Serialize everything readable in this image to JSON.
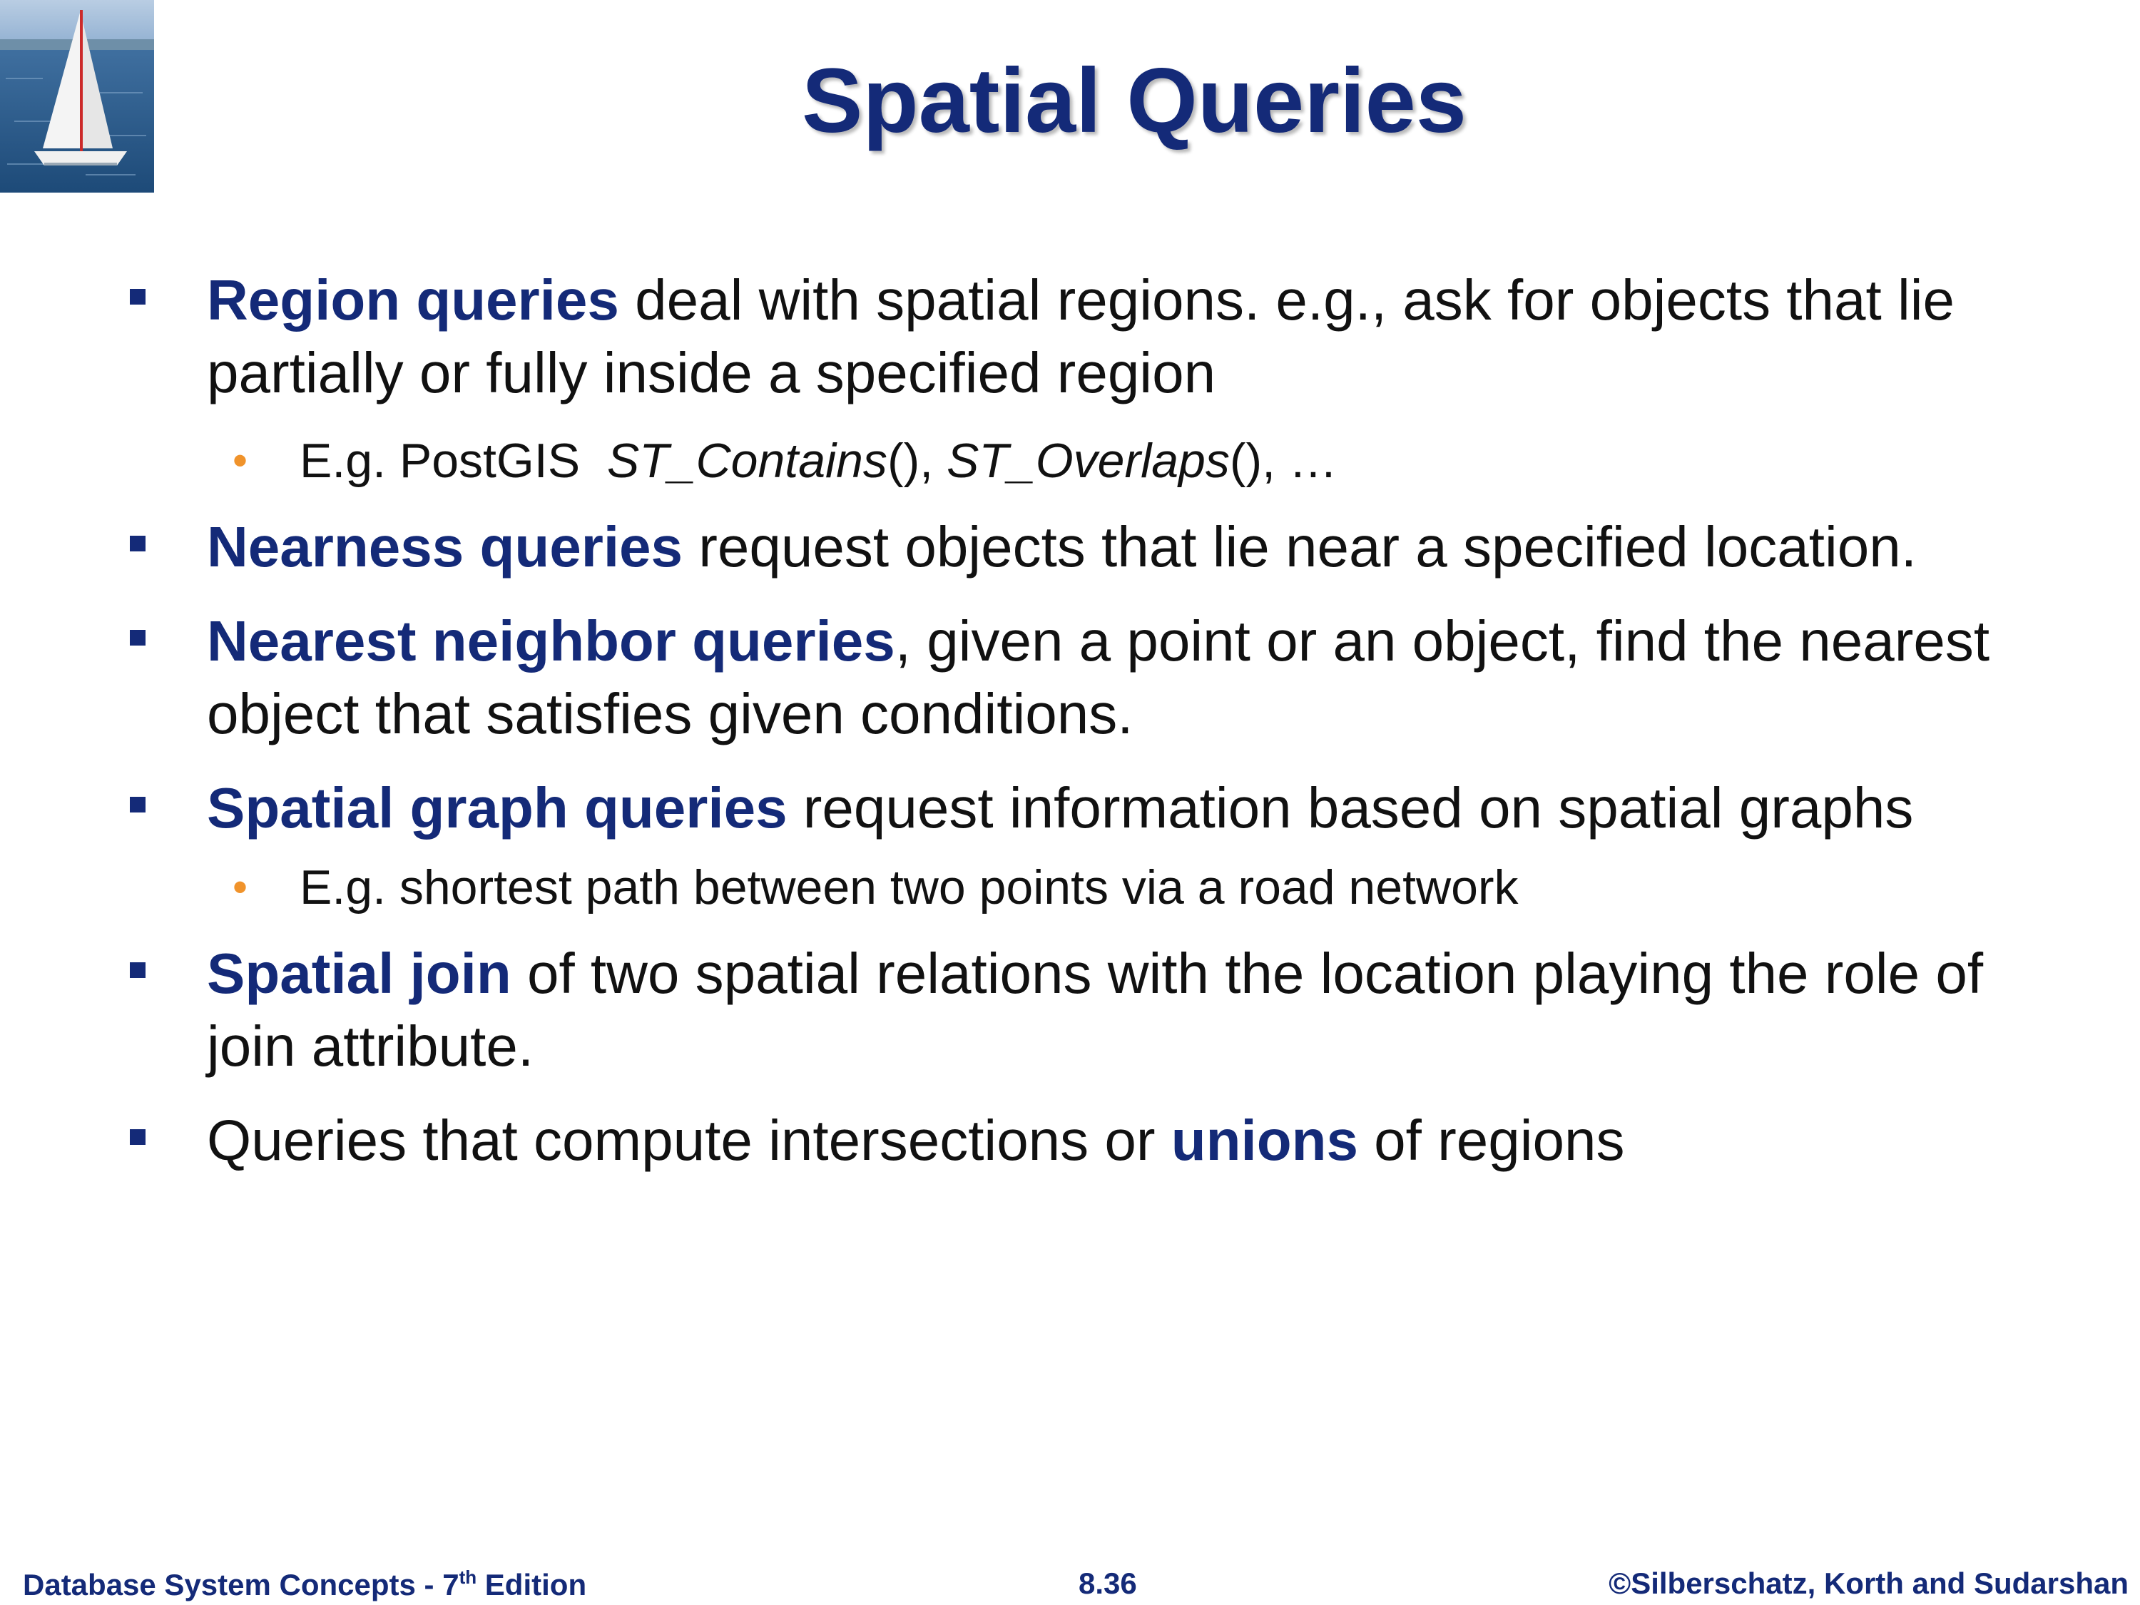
{
  "slide": {
    "title": "Spatial Queries",
    "bullets": [
      {
        "kw": "Region queries",
        "text": " deal with spatial regions. e.g., ask for objects that lie partially or fully inside a specified region"
      },
      {
        "sub": true,
        "prefix": "E.g. PostGIS  ",
        "fn1": "ST_Contains",
        "mid1": "(), ",
        "fn2": "ST_Overlaps",
        "mid2": "(), …"
      },
      {
        "kw": "Nearness queries",
        "text": " request objects that lie near a specified location."
      },
      {
        "kw": "Nearest neighbor queries",
        "text": ", given a point or an object, find the nearest object that satisfies given conditions."
      },
      {
        "kw": "Spatial graph queries",
        "text": " request information based on spatial graphs"
      },
      {
        "sub": true,
        "text": "E.g. shortest path between two points via a road network"
      },
      {
        "kw": "Spatial join",
        "text": " of two spatial relations with the location playing the role of join attribute."
      },
      {
        "pre": "Queries that compute intersections or ",
        "kw": "unions",
        "text": " of regions"
      }
    ]
  },
  "footer": {
    "left_pre": "Database System Concepts - 7",
    "left_sup": "th",
    "left_post": " Edition",
    "center": "8.36",
    "right": "©Silberschatz, Korth and Sudarshan"
  },
  "colors": {
    "accent": "#142a78",
    "sub_bullet": "#f0932b"
  },
  "icons": {
    "logo": "sailboat-logo",
    "bullet": "square-bullet",
    "sub_bullet": "dot-bullet"
  }
}
